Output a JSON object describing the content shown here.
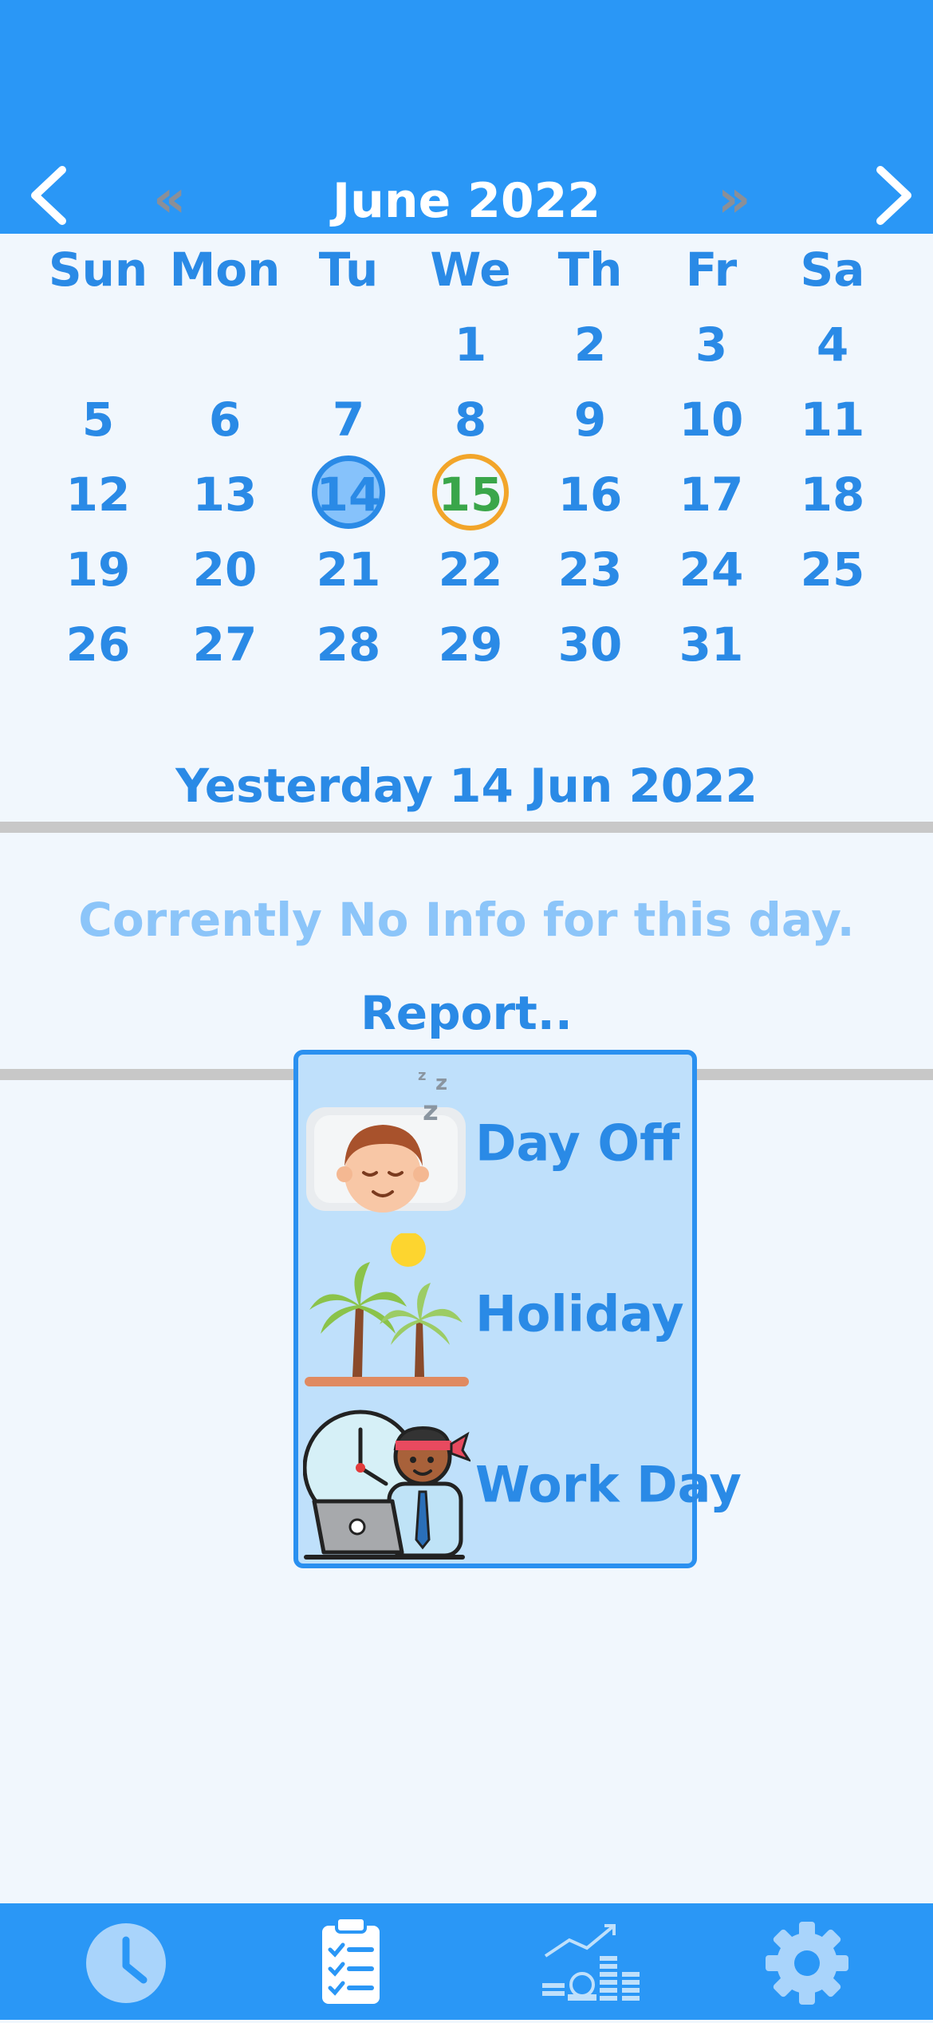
{
  "header": {
    "month_title": "June 2022",
    "prev_year_glyph": "«",
    "next_year_glyph": "»"
  },
  "calendar": {
    "weekdays": [
      "Sun",
      "Mon",
      "Tu",
      "We",
      "Th",
      "Fr",
      "Sa"
    ],
    "weeks": [
      [
        "",
        "",
        "",
        "1",
        "2",
        "3",
        "4"
      ],
      [
        "5",
        "6",
        "7",
        "8",
        "9",
        "10",
        "11"
      ],
      [
        "12",
        "13",
        "14",
        "15",
        "16",
        "17",
        "18"
      ],
      [
        "19",
        "20",
        "21",
        "22",
        "23",
        "24",
        "25"
      ],
      [
        "26",
        "27",
        "28",
        "29",
        "30",
        "31",
        ""
      ]
    ],
    "selected_day": "14",
    "today": "15"
  },
  "detail": {
    "selected_date": "Yesterday 14 Jun 2022",
    "no_info": "Corrently No Info for this day.",
    "report_label": "Report.."
  },
  "report_menu": {
    "items": [
      {
        "label": "Day Off",
        "icon": "sleeping-person-icon"
      },
      {
        "label": "Holiday",
        "icon": "palm-trees-icon"
      },
      {
        "label": "Work Day",
        "icon": "office-worker-icon"
      }
    ]
  },
  "bottom_nav": {
    "tabs": [
      {
        "icon": "clock-icon",
        "active": true
      },
      {
        "icon": "clipboard-checklist-icon",
        "active": false
      },
      {
        "icon": "finance-chart-icon",
        "active": false
      },
      {
        "icon": "gear-icon",
        "active": false
      }
    ]
  },
  "colors": {
    "primary": "#2a97f6",
    "text_blue": "#2a8ae6",
    "selected_fill": "#86c2fb",
    "today_ring": "#f2a52a",
    "today_text": "#3aa64a",
    "menu_bg": "#bfe0fb",
    "background": "#f1f7fd"
  }
}
